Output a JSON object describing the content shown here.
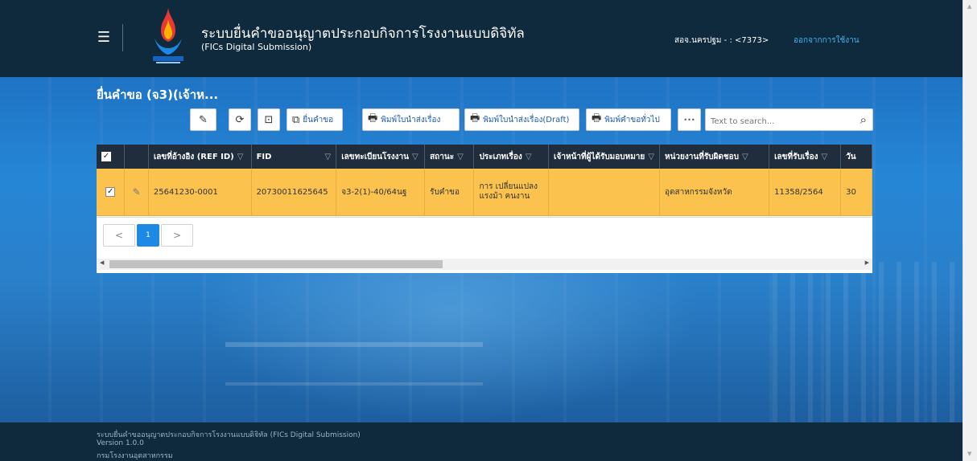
{
  "header": {
    "title": "ระบบยื่นคำขออนุญาตประกอบกิจการโรงงานแบบดิจิทัล",
    "subtitle": "(FICs Digital Submission)",
    "user": "สอจ.นครปฐม - : <7373>",
    "logout": "ออกจากการใช้งาน"
  },
  "page": {
    "title": "ยื่นคำขอ (จ3)(เจ้าห..."
  },
  "toolbar": {
    "submit": "ยื่นคำขอ",
    "print_dispatch": "พิมพ์ใบนำส่งเรื่อง",
    "print_dispatch_draft": "พิมพ์ใบนำส่งเรื่อง(Draft)",
    "print_general": "พิมพ์คำขอทั่วไป",
    "more": "•••",
    "search_placeholder": "Text to search..."
  },
  "grid": {
    "columns": [
      "เลขที่อ้างอิง (REF ID)",
      "FID",
      "เลขทะเบียนโรงงาน",
      "สถานะ",
      "ประเภทเรื่อง",
      "เจ้าหน้าที่ผู้ได้รับมอบหมาย",
      "หน่วยงานที่รับผิดชอบ",
      "เลขที่รับเรื่อง",
      "วัน"
    ],
    "rows": [
      {
        "ref_id": "25641230-0001",
        "fid": "20730011625645",
        "factory_no": "จ3-2(1)-40/64นฐ",
        "status": "รับคำขอ",
        "type": "การ เปลี่ยนแปลง แรงม้า คนงาน",
        "officer": "",
        "agency": "อุตสาหกรรมจังหวัด",
        "receipt_no": "11358/2564",
        "date": "30"
      }
    ]
  },
  "pager": {
    "prev": "<",
    "current": "1",
    "next": ">"
  },
  "footer": {
    "line1": "ระบบยื่นคำขออนุญาตประกอบกิจการโรงงานแบบดิจิทัล (FICs Digital Submission)",
    "line2": "Version 1.0.0",
    "line3": "กรมโรงงานอุตสาหกรรม"
  },
  "colors": {
    "header_bg": "#0f2a3d",
    "row_selected": "#fbc24d",
    "grid_header": "#1f2d3d",
    "link": "#3fb6f2",
    "accent": "#1e88e5"
  }
}
